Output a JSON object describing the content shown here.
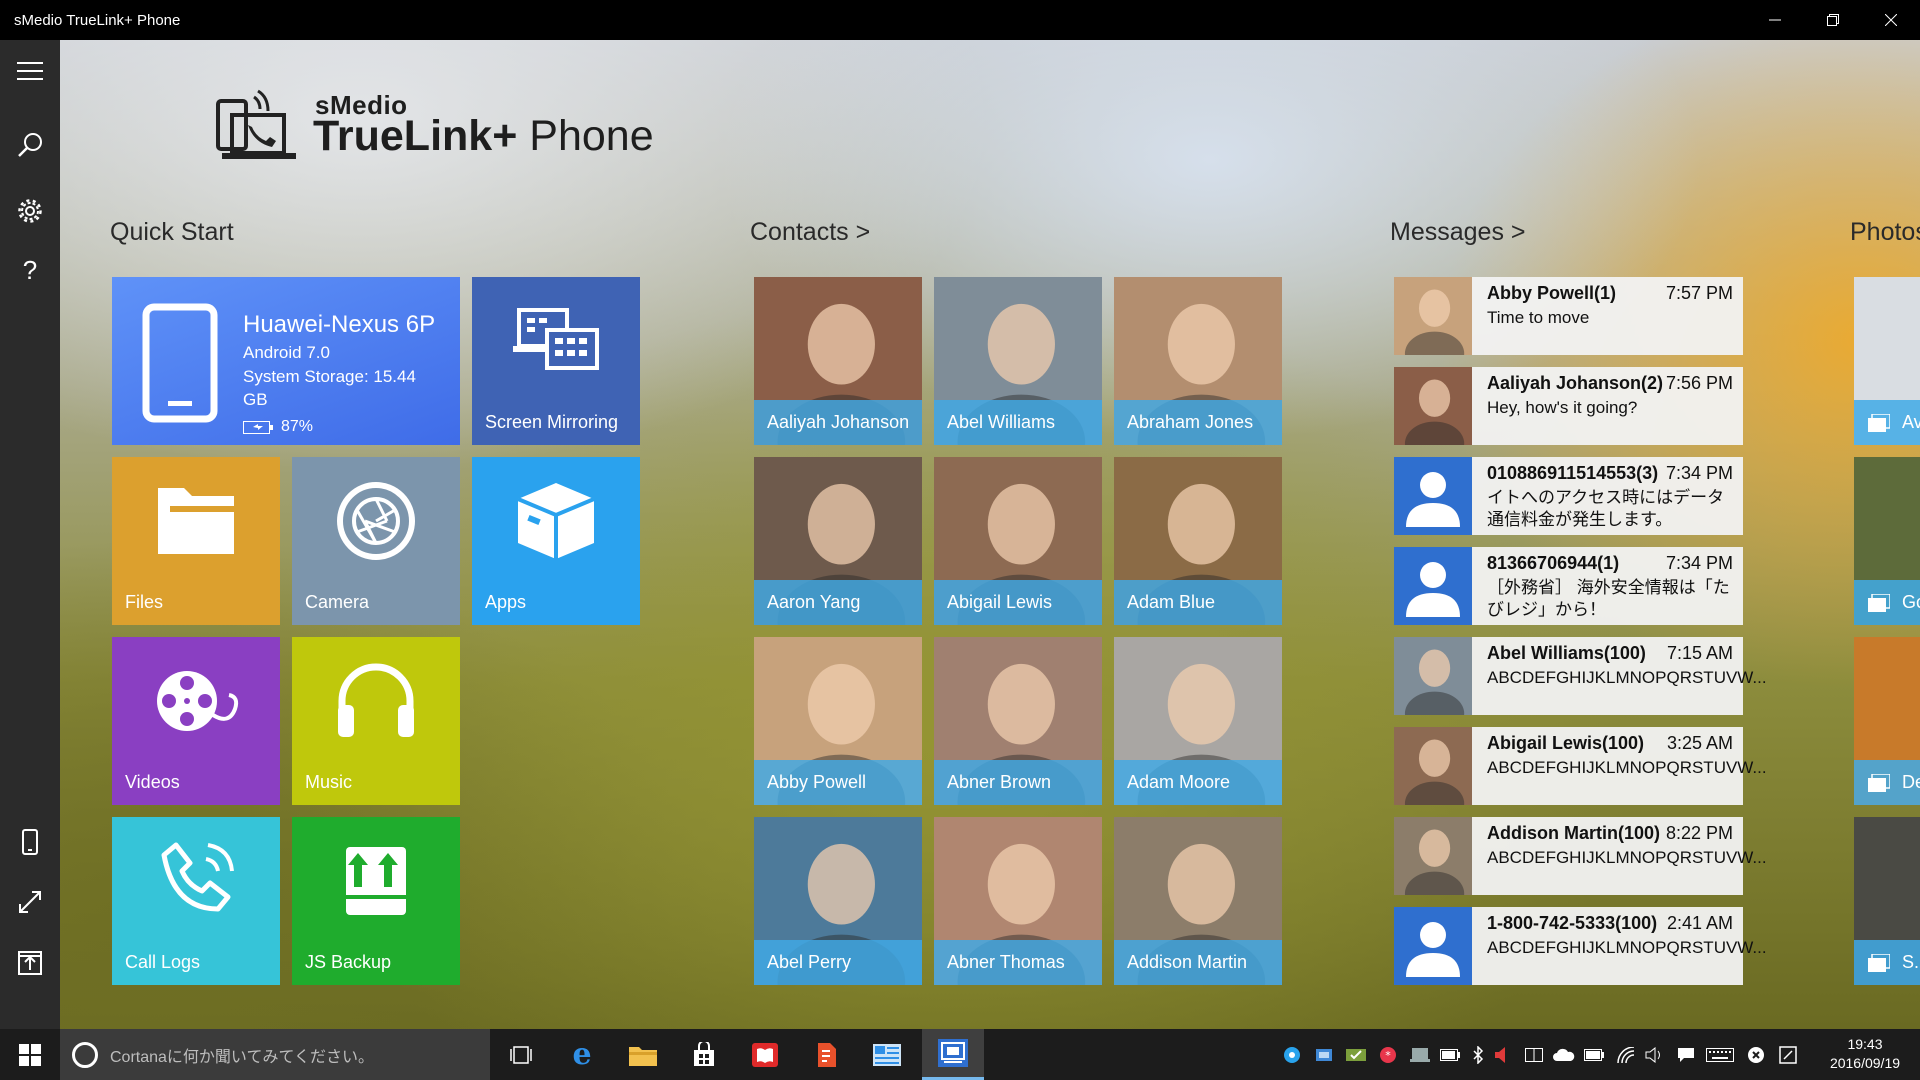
{
  "window": {
    "title": "sMedio TrueLink+ Phone",
    "controls": [
      "minimize-icon",
      "restore-icon",
      "close-icon"
    ]
  },
  "rail": {
    "top_icons": [
      "menu-icon",
      "search-icon",
      "gear-icon",
      "help-icon"
    ],
    "bottom_icons": [
      "phone-icon",
      "fullscreen-icon",
      "export-icon"
    ]
  },
  "logo": {
    "brand": "sMedio",
    "product_bold": "TrueLink+",
    "product_light": "Phone"
  },
  "sections": {
    "quick_start": "Quick Start",
    "contacts": "Contacts >",
    "messages": "Messages >",
    "photos": "Photos"
  },
  "device": {
    "name": "Huawei-Nexus 6P",
    "os": "Android 7.0",
    "storage": "System Storage: 15.44",
    "storage_unit": "GB",
    "battery": "87%"
  },
  "quick_tiles": [
    {
      "id": "screen-mirroring",
      "label": "Screen Mirroring",
      "icon": "screen-mirroring-icon",
      "color": "#3f63b4"
    },
    {
      "id": "files",
      "label": "Files",
      "icon": "folder-icon",
      "color": "#dca02e"
    },
    {
      "id": "camera",
      "label": "Camera",
      "icon": "camera-shutter-icon",
      "color": "#7c95ac"
    },
    {
      "id": "apps",
      "label": "Apps",
      "icon": "box-icon",
      "color": "#2aa2ee"
    },
    {
      "id": "videos",
      "label": "Videos",
      "icon": "film-reel-icon",
      "color": "#8a3fc2"
    },
    {
      "id": "music",
      "label": "Music",
      "icon": "headphones-icon",
      "color": "#bfc80c"
    },
    {
      "id": "call-logs",
      "label": "Call Logs",
      "icon": "phone-call-icon",
      "color": "#36c4d8"
    },
    {
      "id": "js-backup",
      "label": "JS Backup",
      "icon": "backup-icon",
      "color": "#1fac2d"
    }
  ],
  "contacts": [
    {
      "name": "Aaliyah Johanson",
      "photo": "#8b5e48"
    },
    {
      "name": "Abel Williams",
      "photo": "#7f8d98"
    },
    {
      "name": "Abraham Jones",
      "photo": "#b38e6f"
    },
    {
      "name": "Aaron Yang",
      "photo": "#6e5a4c"
    },
    {
      "name": "Abigail Lewis",
      "photo": "#8d6a52"
    },
    {
      "name": "Adam Blue",
      "photo": "#8b6b46"
    },
    {
      "name": "Abby Powell",
      "photo": "#c7a27c"
    },
    {
      "name": "Abner Brown",
      "photo": "#a08070"
    },
    {
      "name": "Adam Moore",
      "photo": "#a9a6a3"
    },
    {
      "name": "Abel Perry",
      "photo": "#4d7a9a"
    },
    {
      "name": "Abner Thomas",
      "photo": "#b08670"
    },
    {
      "name": "Addison Martin",
      "photo": "#8c7d6a"
    }
  ],
  "messages": [
    {
      "name": "Abby Powell(1)",
      "time": "7:57 PM",
      "body": "Time to move",
      "avatar": "photo",
      "color": "#c7a27c"
    },
    {
      "name": "Aaliyah Johanson(2)",
      "time": "7:56 PM",
      "body": "Hey, how's it going?",
      "avatar": "photo",
      "color": "#8b5e48"
    },
    {
      "name": "010886911514553(3)",
      "time": "7:34 PM",
      "body": "イトへのアクセス時にはデータ通信料金が発生します。",
      "avatar": "default",
      "color": "#2f6fcf"
    },
    {
      "name": "81366706944(1)",
      "time": "7:34 PM",
      "body": "［外務省］ 海外安全情報は「たびレジ」から！",
      "avatar": "default",
      "color": "#2f6fcf"
    },
    {
      "name": "Abel Williams(100)",
      "time": "7:15 AM",
      "body": "ABCDEFGHIJKLMNOPQRSTUVW...",
      "avatar": "photo",
      "color": "#7f8d98"
    },
    {
      "name": "Abigail Lewis(100)",
      "time": "3:25 AM",
      "body": "ABCDEFGHIJKLMNOPQRSTUVW...",
      "avatar": "photo",
      "color": "#8d6a52"
    },
    {
      "name": "Addison Martin(100)",
      "time": "8:22 PM",
      "body": "ABCDEFGHIJKLMNOPQRSTUVW...",
      "avatar": "photo",
      "color": "#8c7d6a"
    },
    {
      "name": "1-800-742-5333(100)",
      "time": "2:41 AM",
      "body": "ABCDEFGHIJKLMNOPQRSTUVW...",
      "avatar": "default",
      "color": "#2f6fcf"
    }
  ],
  "photos": [
    {
      "label": "Av",
      "color": "#d9dde2"
    },
    {
      "label": "Gc",
      "color": "#5d6b3a"
    },
    {
      "label": "De",
      "color": "#c87a2a"
    },
    {
      "label": "S...",
      "color": "#4a4a44"
    }
  ],
  "taskbar": {
    "search_placeholder": "Cortanaに何か聞いてみてください。",
    "apps": [
      "task-view-icon",
      "edge-icon",
      "file-explorer-icon",
      "store-icon",
      "reader-icon",
      "app-red-icon",
      "app-blue-icon",
      "truelink-icon"
    ],
    "time": "19:43",
    "date": "2016/09/19"
  }
}
